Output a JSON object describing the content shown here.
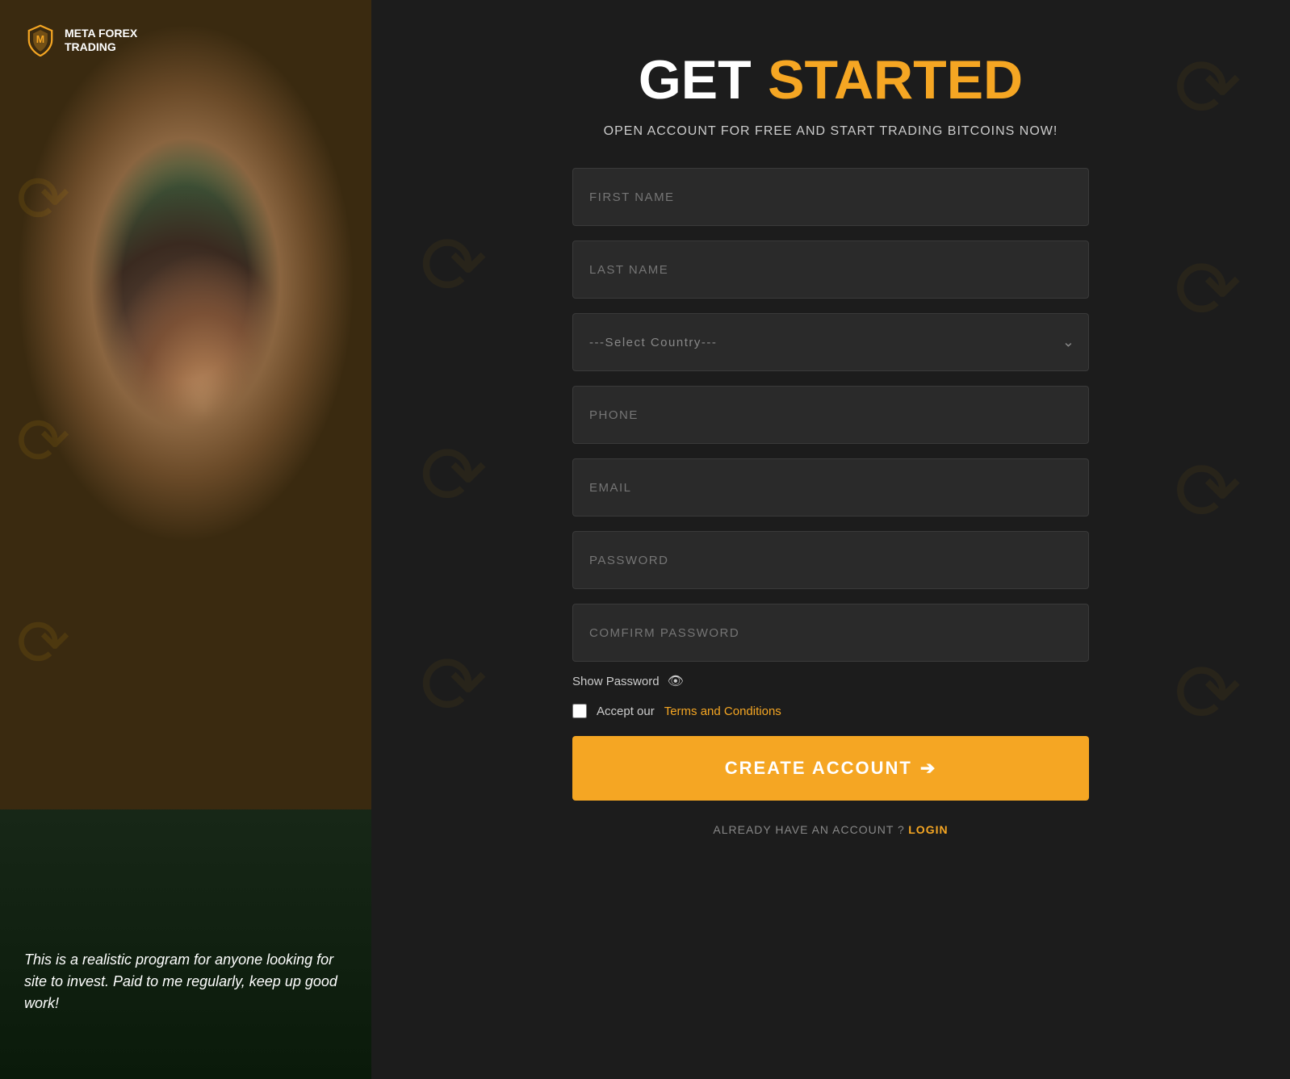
{
  "logo": {
    "line1": "META FOREX",
    "line2": "TRADING"
  },
  "heading": {
    "get": "GET",
    "started": "STARTED"
  },
  "subheading": "OPEN ACCOUNT FOR FREE AND START TRADING BITCOINS NOW!",
  "form": {
    "first_name_placeholder": "FIRST NAME",
    "last_name_placeholder": "LAST NAME",
    "country_placeholder": "---Select Country---",
    "phone_placeholder": "PHONE",
    "email_placeholder": "EMAIL",
    "password_placeholder": "PASSWORD",
    "confirm_password_placeholder": "COMFIRM PASSWORD"
  },
  "show_password_label": "Show Password",
  "terms": {
    "prefix": "Accept our",
    "link_label": "Terms and Conditions"
  },
  "create_account_btn": "CREATE ACCOUNT",
  "arrow_icon": "➔",
  "login": {
    "prompt": "ALREADY HAVE AN ACCOUNT ?",
    "link": "LOGIN"
  },
  "testimonial": "This is a realistic program for anyone looking for site to invest. Paid to me regularly, keep up good work!"
}
